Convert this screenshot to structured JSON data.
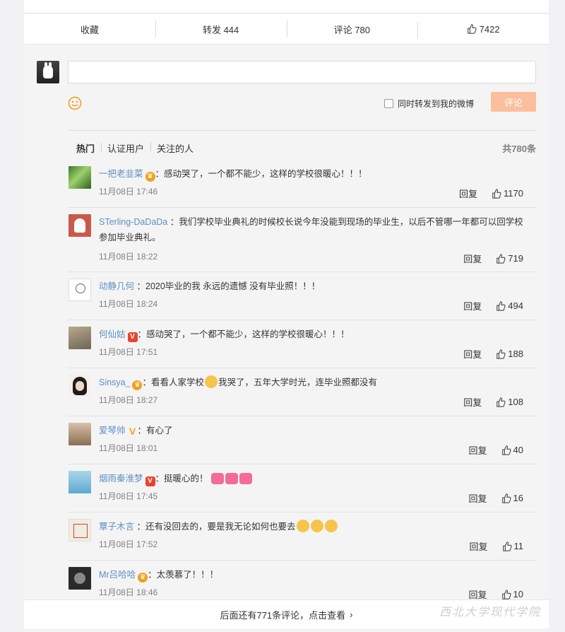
{
  "actions": {
    "favorite": "收藏",
    "repost": "转发 444",
    "comment": "评论 780",
    "like": "7422"
  },
  "compose": {
    "input_placeholder": "",
    "repost_checkbox_label": "同时转发到我的微博",
    "submit_label": "评论"
  },
  "filters": {
    "tabs": [
      "热门",
      "认证用户",
      "关注的人"
    ],
    "total": "共780条"
  },
  "comments": [
    {
      "user": "一把老韭菜",
      "text": "：感动哭了，一个都不能少，这样的学校很暖心！！！",
      "time": "11月08日 17:46",
      "reply": "回复",
      "likes": "1170"
    },
    {
      "user": "STerling-DaDaDa",
      "text": "：我们学校毕业典礼的时候校长说今年没能到现场的毕业生，以后不管哪一年都可以回学校参加毕业典礼。",
      "time": "11月08日 18:22",
      "reply": "回复",
      "likes": "719"
    },
    {
      "user": "动静几何",
      "text": "：2020毕业的我 永远的遗憾 没有毕业照！！！",
      "time": "11月08日 18:24",
      "reply": "回复",
      "likes": "494"
    },
    {
      "user": "何仙姑",
      "text": "：感动哭了，一个都不能少，这样的学校很暖心！！！",
      "time": "11月08日 17:51",
      "reply": "回复",
      "likes": "188"
    },
    {
      "user": "Sinsya_",
      "text_before": "：看看人家学校",
      "text_after": "我哭了，五年大学时光，连毕业照都没有",
      "time": "11月08日 18:27",
      "reply": "回复",
      "likes": "108"
    },
    {
      "user": "爱琴帅",
      "text": "：有心了",
      "time": "11月08日 18:01",
      "reply": "回复",
      "likes": "40"
    },
    {
      "user": "烟雨秦淮梦",
      "text": "：挺暖心的！",
      "time": "11月08日 17:45",
      "reply": "回复",
      "likes": "16"
    },
    {
      "user": "覃子木言",
      "text": "：还有没回去的，要是我无论如何也要去",
      "time": "11月08日 17:52",
      "reply": "回复",
      "likes": "11"
    },
    {
      "user": "Mr吕哈哈",
      "text": "：太羡慕了！！！",
      "time": "11月08日 18:46",
      "reply": "回复",
      "likes": "10"
    }
  ],
  "more": "后面还有771条评论，点击查看",
  "watermark": "西北大学现代学院"
}
